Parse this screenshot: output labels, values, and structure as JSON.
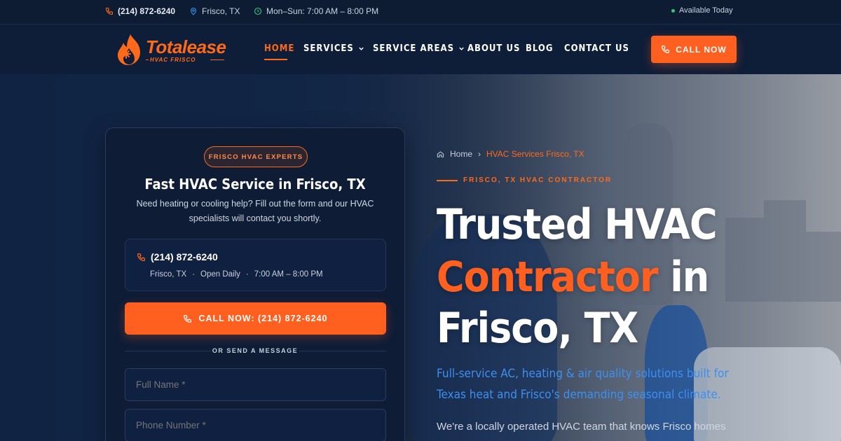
{
  "topbar": {
    "phone": "(214) 872-6240",
    "location": "Frisco, TX",
    "hours": "Mon–Sun: 7:00 AM – 8:00 PM",
    "availability": "Available Today"
  },
  "brand": {
    "name": "Totalease",
    "tagline": "HVAC FRISCO",
    "accent_color": "#ff5f1f"
  },
  "nav": {
    "items": [
      {
        "label": "HOME",
        "active": true
      },
      {
        "label": "SERVICES",
        "dropdown": true
      },
      {
        "label": "SERVICE AREAS",
        "dropdown": true
      },
      {
        "label": "ABOUT US"
      },
      {
        "label": "BLOG"
      },
      {
        "label": "CONTACT US"
      }
    ],
    "cta": "CALL NOW"
  },
  "form_card": {
    "badge": "FRISCO HVAC EXPERTS",
    "title": "Fast HVAC Service in Frisco, TX",
    "description": "Need heating or cooling help? Fill out the form and our HVAC specialists will contact you shortly.",
    "contact": {
      "phone": "(214) 872-6240",
      "city": "Frisco, TX",
      "open": "Open Daily",
      "hours": "7:00 AM – 8:00 PM"
    },
    "call_button": "CALL NOW: (214) 872-6240",
    "divider": "OR SEND A MESSAGE",
    "fields": {
      "name_placeholder": "Full Name *",
      "phone_placeholder": "Phone Number *"
    }
  },
  "hero": {
    "breadcrumb": {
      "home": "Home",
      "current": "HVAC Services Frisco, TX"
    },
    "eyebrow": "FRISCO, TX HVAC CONTRACTOR",
    "headline": {
      "line1": "Trusted HVAC",
      "accent": "Contractor",
      "line2_rest": " in",
      "line3": "Frisco, TX"
    },
    "lead": "Full-service AC, heating & air quality solutions built for Texas heat and Frisco's demanding seasonal climate.",
    "body": "We're a locally operated HVAC team that knows Frisco homes"
  }
}
